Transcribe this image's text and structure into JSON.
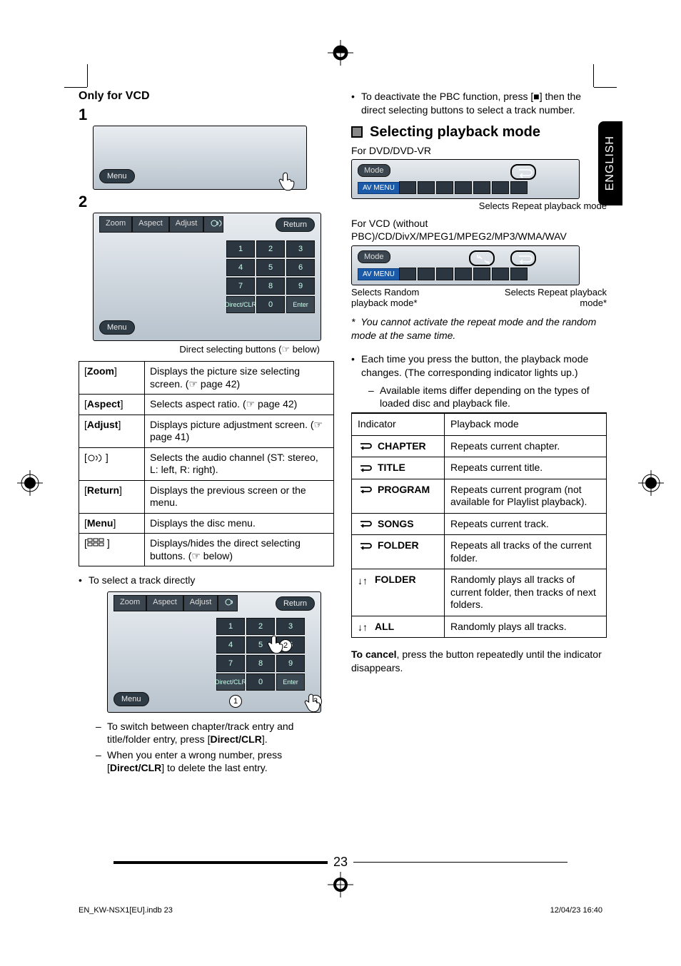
{
  "page_number": "23",
  "footer_left": "EN_KW-NSX1[EU].indb   23",
  "footer_right": "12/04/23   16:40",
  "sidetab": "ENGLISH",
  "left": {
    "only_for_vcd": "Only for VCD",
    "step1": "1",
    "step2": "2",
    "menu_label": "Menu",
    "tabs": {
      "zoom": "Zoom",
      "aspect": "Aspect",
      "adjust": "Adjust",
      "audio": "",
      "return": "Return"
    },
    "numpad": [
      "1",
      "2",
      "3",
      "4",
      "5",
      "6",
      "7",
      "8",
      "9",
      "Direct/CLR",
      "0",
      "Enter"
    ],
    "caption_direct": "Direct selecting buttons (☞ below)",
    "table": [
      {
        "k": "[Zoom]",
        "v": "Displays the picture size selecting screen. (☞ page 42)"
      },
      {
        "k": "[Aspect]",
        "v": "Selects aspect ratio. (☞ page 42)"
      },
      {
        "k": "[Adjust]",
        "v": "Displays picture adjustment screen. (☞ page 41)"
      },
      {
        "k": "audio_icon",
        "v": "Selects the audio channel (ST: stereo, L: left, R: right)."
      },
      {
        "k": "[Return]",
        "v": "Displays the previous screen or the menu."
      },
      {
        "k": "[Menu]",
        "v": "Displays the disc menu."
      },
      {
        "k": "keypad_icon",
        "v": "Displays/hides the direct selecting buttons. (☞ below)"
      }
    ],
    "bullet_select_track": "To select a track directly",
    "dash1_a": "To switch between chapter/track entry and title/folder entry, press [",
    "dash1_b": "Direct/CLR",
    "dash1_c": "].",
    "dash2_a": "When you enter a wrong number, press [",
    "dash2_b": "Direct/CLR",
    "dash2_c": "] to delete the last entry."
  },
  "right": {
    "bullet_pbc": "To deactivate the PBC function, press [■] then the direct selecting buttons to select a track number.",
    "sec_title": "Selecting playback mode",
    "for_dvd": "For DVD/DVD-VR",
    "mode_label": "Mode",
    "avmenu_label": "AV MENU",
    "cap_repeat_only": "Selects Repeat playback mode",
    "for_vcd": "For VCD (without PBC)/CD/DivX/MPEG1/MPEG2/MP3/WMA/WAV",
    "cap_random": "Selects Random playback mode*",
    "cap_repeat": "Selects Repeat playback mode*",
    "note_star": "You cannot activate the repeat mode and the random mode at the same time.",
    "bullet_each": "Each time you press the button, the playback mode changes. (The corresponding indicator lights up.)",
    "dash_avail": "Available items differ depending on the types of loaded disc and playback file.",
    "th_ind": "Indicator",
    "th_mode": "Playback mode",
    "rows": [
      {
        "icon": "loop",
        "label": "CHAPTER",
        "mode": "Repeats current chapter."
      },
      {
        "icon": "loop",
        "label": "TITLE",
        "mode": "Repeats current title."
      },
      {
        "icon": "loop",
        "label": "PROGRAM",
        "mode": "Repeats current program (not available for Playlist playback)."
      },
      {
        "icon": "loop",
        "label": "SONGS",
        "mode": "Repeats current track."
      },
      {
        "icon": "loop",
        "label": "FOLDER",
        "mode": "Repeats all tracks of the current folder."
      },
      {
        "icon": "shuf",
        "label": "FOLDER",
        "mode": "Randomly plays all tracks of current folder, then tracks of next folders."
      },
      {
        "icon": "shuf",
        "label": "ALL",
        "mode": "Randomly plays all tracks."
      }
    ],
    "cancel_a": "To cancel",
    "cancel_b": ", press the button repeatedly until the indicator disappears."
  }
}
